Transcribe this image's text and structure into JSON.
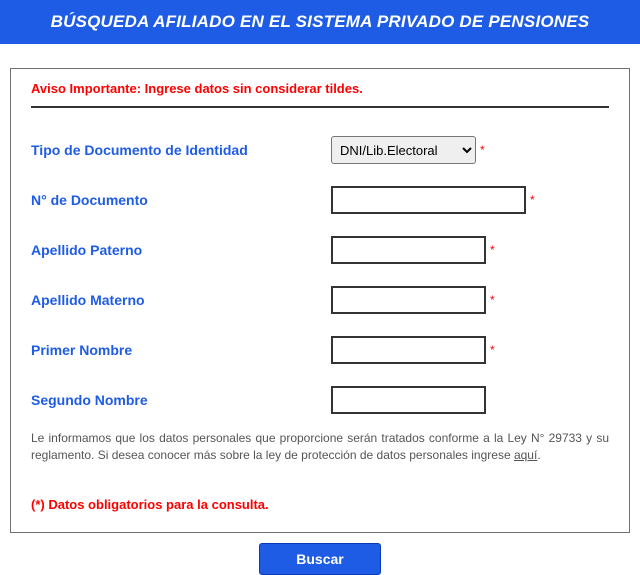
{
  "header": {
    "title": "BÚSQUEDA AFILIADO EN EL SISTEMA PRIVADO DE PENSIONES"
  },
  "aviso": "Aviso Importante: Ingrese datos sin considerar tildes.",
  "fields": {
    "doc_type": {
      "label": "Tipo de Documento de Identidad",
      "value": "DNI/Lib.Electoral",
      "required": "*"
    },
    "doc_num": {
      "label": "N° de Documento",
      "value": "",
      "required": "*"
    },
    "ap_pat": {
      "label": "Apellido Paterno",
      "value": "",
      "required": "*"
    },
    "ap_mat": {
      "label": "Apellido Materno",
      "value": "",
      "required": "*"
    },
    "nom1": {
      "label": "Primer Nombre",
      "value": "",
      "required": "*"
    },
    "nom2": {
      "label": "Segundo Nombre",
      "value": "",
      "required": ""
    }
  },
  "disclaimer": {
    "text": "Le informamos que los datos personales que proporcione serán tratados conforme a la Ley N° 29733 y su reglamento. Si desea conocer más sobre la ley de protección de datos personales ingrese ",
    "link_text": "aquí",
    "suffix": "."
  },
  "required_note": "(*) Datos obligatorios para la consulta.",
  "buttons": {
    "search": "Buscar"
  }
}
